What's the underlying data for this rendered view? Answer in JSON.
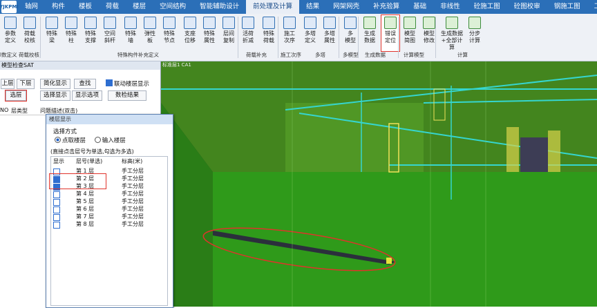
{
  "logo_text": "YJKPMI",
  "menu": [
    "轴网",
    "构件",
    "楼板",
    "荷载",
    "楼层",
    "空间结构",
    "智能辅助设计",
    "前处理及计算",
    "结果",
    "网架网壳",
    "补充验算",
    "基础",
    "非线性",
    "砼施工图",
    "砼图校审",
    "钢施工图",
    "工具集"
  ],
  "active_menu_index": 7,
  "ribbon": {
    "buttons": [
      {
        "l1": "参数",
        "l2": "定义",
        "icon": "params-icon"
      },
      {
        "l1": "荷载",
        "l2": "校核",
        "icon": "load-check-icon"
      },
      {
        "l1": "特殊",
        "l2": "梁",
        "icon": "special-beam-icon"
      },
      {
        "l1": "特殊",
        "l2": "柱",
        "icon": "special-column-icon"
      },
      {
        "l1": "特殊",
        "l2": "支撑",
        "icon": "special-brace-icon"
      },
      {
        "l1": "空间",
        "l2": "斜杆",
        "icon": "space-rod-icon"
      },
      {
        "l1": "特殊",
        "l2": "墙",
        "icon": "special-wall-icon"
      },
      {
        "l1": "弹性",
        "l2": "板",
        "icon": "elastic-slab-icon"
      },
      {
        "l1": "特殊",
        "l2": "节点",
        "icon": "special-node-icon"
      },
      {
        "l1": "支座",
        "l2": "位移",
        "icon": "support-disp-icon"
      },
      {
        "l1": "特殊",
        "l2": "属性",
        "icon": "special-prop-icon"
      },
      {
        "l1": "层间",
        "l2": "复制",
        "icon": "layer-copy-icon"
      },
      {
        "l1": "活荷",
        "l2": "折减",
        "icon": "live-load-icon"
      },
      {
        "l1": "特殊",
        "l2": "荷载",
        "icon": "special-load-icon"
      },
      {
        "l1": "施工",
        "l2": "次序",
        "icon": "construction-order-icon"
      },
      {
        "l1": "多塔",
        "l2": "定义",
        "icon": "multi-tower-define-icon"
      },
      {
        "l1": "多塔",
        "l2": "属性",
        "icon": "multi-tower-prop-icon"
      },
      {
        "l1": "多",
        "l2": "模型",
        "icon": "multi-model-icon"
      },
      {
        "l1": "生成",
        "l2": "数据",
        "icon": "generate-data-icon"
      },
      {
        "l1": "错误",
        "l2": "定位",
        "icon": "error-locate-icon"
      },
      {
        "l1": "模型",
        "l2": "简图",
        "icon": "model-sketch-icon"
      },
      {
        "l1": "模型",
        "l2": "修改",
        "icon": "model-modify-icon"
      },
      {
        "l1": "生成数据",
        "l2": "+全部计算",
        "icon": "generate-calc-icon"
      },
      {
        "l1": "分步",
        "l2": "计算",
        "icon": "step-calc-icon"
      }
    ],
    "groups": [
      "l数定义 荷载校核",
      "特殊构件补充定义",
      "荷载补充",
      "施工次序",
      "多塔",
      "多模型",
      "生成数据",
      "计算模型",
      "计算"
    ]
  },
  "left_panel": {
    "title": "模型检查SAT",
    "buttons": [
      "上层",
      "下层",
      "简化显示",
      "查找",
      "选层",
      "选择显示",
      "显示选项",
      "数检结果"
    ],
    "linked_checkbox": "联动楼层显示",
    "columns": [
      "NO",
      "层类型",
      "问题描述(双击)"
    ]
  },
  "viewport": {
    "label": "标准层1 CA1"
  },
  "dialog": {
    "title": "楼层显示",
    "group_label": "选择方式",
    "radio_1": "点取楼层",
    "radio_2": "输入楼层",
    "hint": "(直接点击层号为单选,勾选为多选)",
    "columns": [
      "显示",
      "层号(单选)",
      "标高(米)"
    ],
    "rows": [
      {
        "checked": false,
        "floor": "第 1 层",
        "height": "手工分层"
      },
      {
        "checked": true,
        "floor": "第 2 层",
        "height": "手工分层"
      },
      {
        "checked": true,
        "floor": "第 3 层",
        "height": "手工分层"
      },
      {
        "checked": false,
        "floor": "第 4 层",
        "height": "手工分层"
      },
      {
        "checked": false,
        "floor": "第 5 层",
        "height": "手工分层"
      },
      {
        "checked": false,
        "floor": "第 6 层",
        "height": "手工分层"
      },
      {
        "checked": false,
        "floor": "第 7 层",
        "height": "手工分层"
      },
      {
        "checked": false,
        "floor": "第 8 层",
        "height": "手工分层"
      }
    ]
  },
  "watermark": "大跛跨境"
}
